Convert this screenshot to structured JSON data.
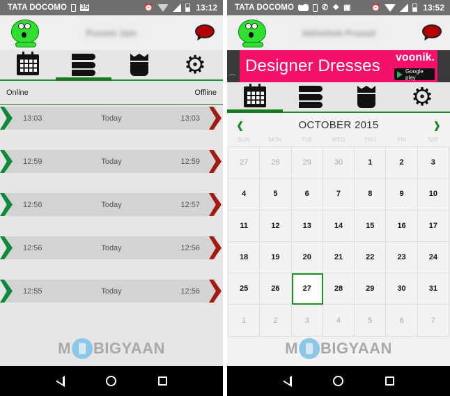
{
  "left": {
    "status_bar": {
      "carrier": "TATA DOCOMO",
      "badge": "35",
      "time": "13:12"
    },
    "header": {
      "title": "Puneet Jain"
    },
    "tabs": [
      {
        "name": "calendar",
        "icon": "calendar-icon",
        "active": false
      },
      {
        "name": "history",
        "icon": "stack-icon",
        "active": true
      },
      {
        "name": "premium",
        "icon": "crown-icon",
        "active": false
      },
      {
        "name": "settings",
        "icon": "gear-icon",
        "active": false
      }
    ],
    "list_header": {
      "online_label": "Online",
      "offline_label": "Offline"
    },
    "sessions": [
      {
        "online": "13:03",
        "day": "Today",
        "offline": "13:03"
      },
      {
        "online": "12:59",
        "day": "Today",
        "offline": "12:59"
      },
      {
        "online": "12:56",
        "day": "Today",
        "offline": "12:57"
      },
      {
        "online": "12:56",
        "day": "Today",
        "offline": "12:56"
      },
      {
        "online": "12:55",
        "day": "Today",
        "offline": "12:56"
      }
    ],
    "watermark": {
      "before": "M",
      "after": "BIGYAAN"
    }
  },
  "right": {
    "status_bar": {
      "carrier": "TATA DOCOMO",
      "time": "13:52"
    },
    "header": {
      "title": "Abhishek Prasad"
    },
    "ad": {
      "text": "Designer Dresses",
      "brand": "voonik.",
      "store": "Google play"
    },
    "tabs": [
      {
        "name": "calendar",
        "icon": "calendar-icon",
        "active": true
      },
      {
        "name": "history",
        "icon": "stack-icon",
        "active": false
      },
      {
        "name": "premium",
        "icon": "crown-icon",
        "active": false
      },
      {
        "name": "settings",
        "icon": "gear-icon",
        "active": false
      }
    ],
    "calendar": {
      "month_title": "OCTOBER 2015",
      "prev_icon": "‹",
      "next_icon": "›",
      "weekdays": [
        "SUN",
        "MON",
        "TUE",
        "WED",
        "THU",
        "FRI",
        "SAT"
      ],
      "selected_day": "27",
      "days": [
        {
          "d": "27",
          "m": true
        },
        {
          "d": "28",
          "m": true
        },
        {
          "d": "29",
          "m": true
        },
        {
          "d": "30",
          "m": true
        },
        {
          "d": "1"
        },
        {
          "d": "2"
        },
        {
          "d": "3"
        },
        {
          "d": "4"
        },
        {
          "d": "5"
        },
        {
          "d": "6"
        },
        {
          "d": "7"
        },
        {
          "d": "8"
        },
        {
          "d": "9"
        },
        {
          "d": "10"
        },
        {
          "d": "11"
        },
        {
          "d": "12"
        },
        {
          "d": "13"
        },
        {
          "d": "14"
        },
        {
          "d": "15"
        },
        {
          "d": "16"
        },
        {
          "d": "17"
        },
        {
          "d": "18"
        },
        {
          "d": "19"
        },
        {
          "d": "20"
        },
        {
          "d": "21"
        },
        {
          "d": "22"
        },
        {
          "d": "23"
        },
        {
          "d": "24"
        },
        {
          "d": "25"
        },
        {
          "d": "26"
        },
        {
          "d": "27",
          "sel": true
        },
        {
          "d": "28"
        },
        {
          "d": "29"
        },
        {
          "d": "30"
        },
        {
          "d": "31"
        },
        {
          "d": "1",
          "m": true
        },
        {
          "d": "2",
          "m": true
        },
        {
          "d": "3",
          "m": true
        },
        {
          "d": "4",
          "m": true
        },
        {
          "d": "5",
          "m": true
        },
        {
          "d": "6",
          "m": true
        },
        {
          "d": "7",
          "m": true
        }
      ]
    },
    "watermark": {
      "before": "M",
      "after": "BIGYAAN"
    }
  },
  "colors": {
    "online_green": "#0f8a3a",
    "offline_red": "#a21a10",
    "tab_indicator": "#1b7a1f",
    "ad_pink": "#f5106a",
    "selected_outline": "#1e8f26"
  }
}
